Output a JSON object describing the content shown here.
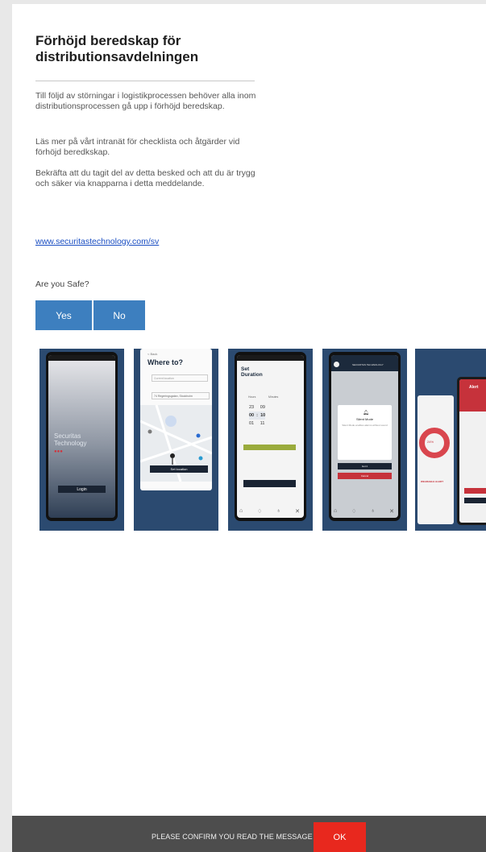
{
  "message": {
    "title": "Förhöjd beredskap för distributionsavdelningen",
    "paragraphs": [
      "Till följd av störningar i logistikprocessen behöver alla inom distributionsprocessen gå upp i förhöjd beredskap.",
      "Läs mer på vårt intranät för checklista och åtgärder vid förhöjd beredkskap.",
      "Bekräfta att du tagit del av detta besked och att du är trygg och säker via knapparna i detta meddelande."
    ],
    "link": "www.securitastechnology.com/sv",
    "question": "Are you Safe?",
    "yes_label": "Yes",
    "no_label": "No"
  },
  "screenshots": {
    "s1": {
      "brand_line1": "Securitas",
      "brand_line2": "Technology",
      "button": "Login"
    },
    "s2": {
      "back": "< Back",
      "title": "Where to?",
      "field_start": "Current location",
      "field_dest": "74 Regeringsgatan, Stockholm",
      "button": "Set location"
    },
    "s3": {
      "title_line1": "Set",
      "title_line2": "Duration",
      "col_hours": "Hours",
      "col_minutes": "Minutes",
      "rows": [
        [
          "23",
          "09"
        ],
        [
          "00",
          "10"
        ],
        [
          "01",
          "11"
        ]
      ],
      "button": ""
    },
    "s4": {
      "header": "SECURITAS TECHNOLOGY",
      "dialog_title": "Silent Mode",
      "dialog_text": "Silent Mode enables alarms without sound",
      "button_primary": "Got it",
      "button_cancel": "Cancel"
    },
    "s5": {
      "banner": "Alert",
      "percent": "24%",
      "label": "WEARABLE ALERT"
    }
  },
  "colors": {
    "card_bg": "#2b4a70",
    "primary_blue": "#3d7fbf",
    "ok_red": "#e8281e",
    "footer_bg": "#4d4d4d"
  },
  "footer": {
    "text": "PLEASE CONFIRM YOU READ THE MESSAGE",
    "ok_label": "OK"
  }
}
